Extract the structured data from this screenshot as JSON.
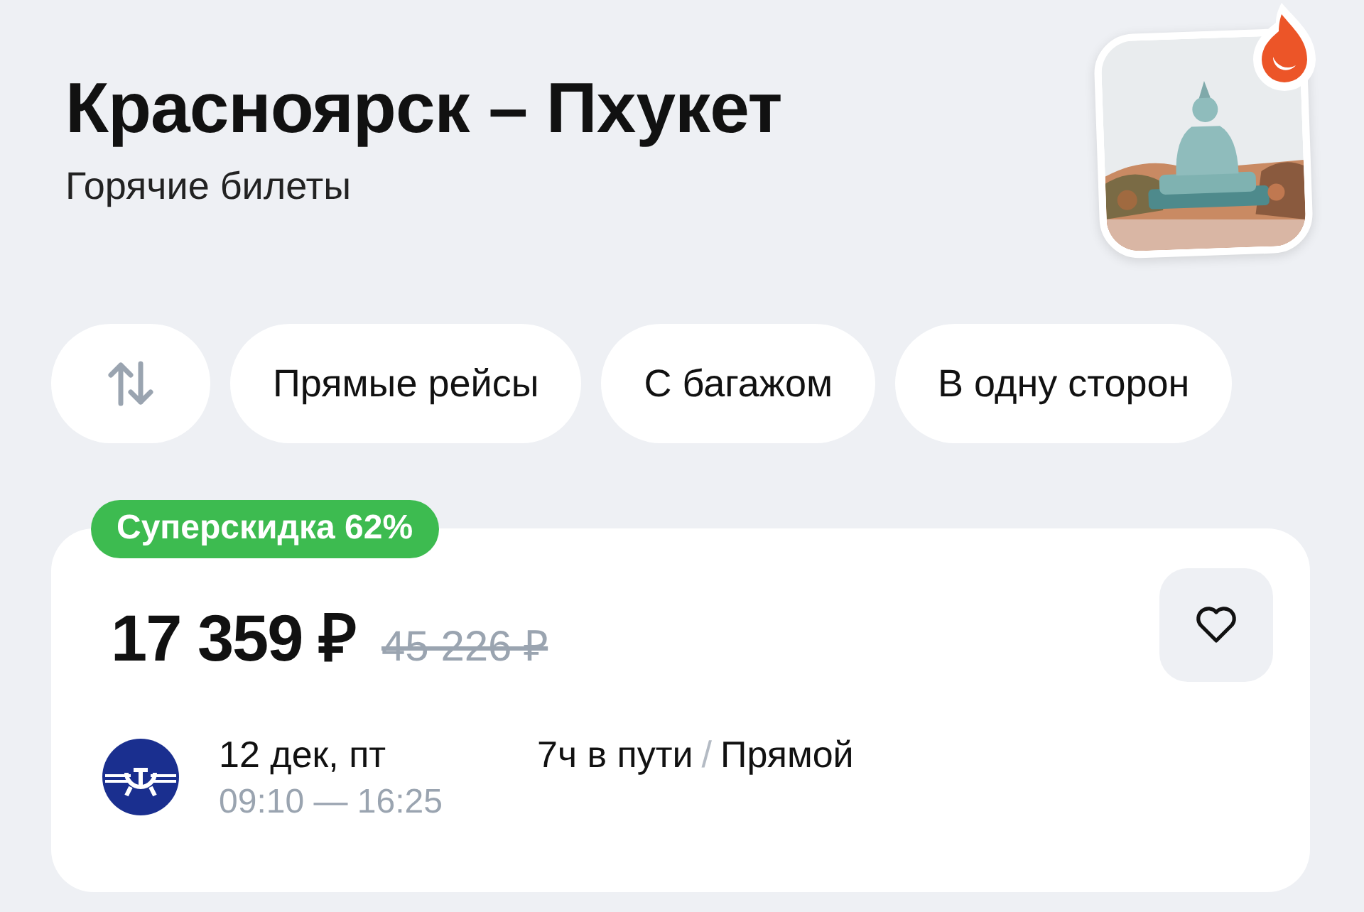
{
  "header": {
    "title": "Красноярск – Пхукет",
    "subtitle": "Горячие билеты"
  },
  "filters": [
    {
      "kind": "sort"
    },
    {
      "kind": "chip",
      "label": "Прямые рейсы"
    },
    {
      "kind": "chip",
      "label": "С багажом"
    },
    {
      "kind": "chip",
      "label": "В одну сторон"
    }
  ],
  "ticket": {
    "badge": "Суперскидка 62%",
    "price": "17 359 ₽",
    "old_price": "45 226 ₽",
    "date": "12 дек, пт",
    "departure": "09:10",
    "time_separator": "—",
    "arrival": "16:25",
    "duration": "7ч в пути",
    "separator": "/",
    "route_type": "Прямой"
  }
}
